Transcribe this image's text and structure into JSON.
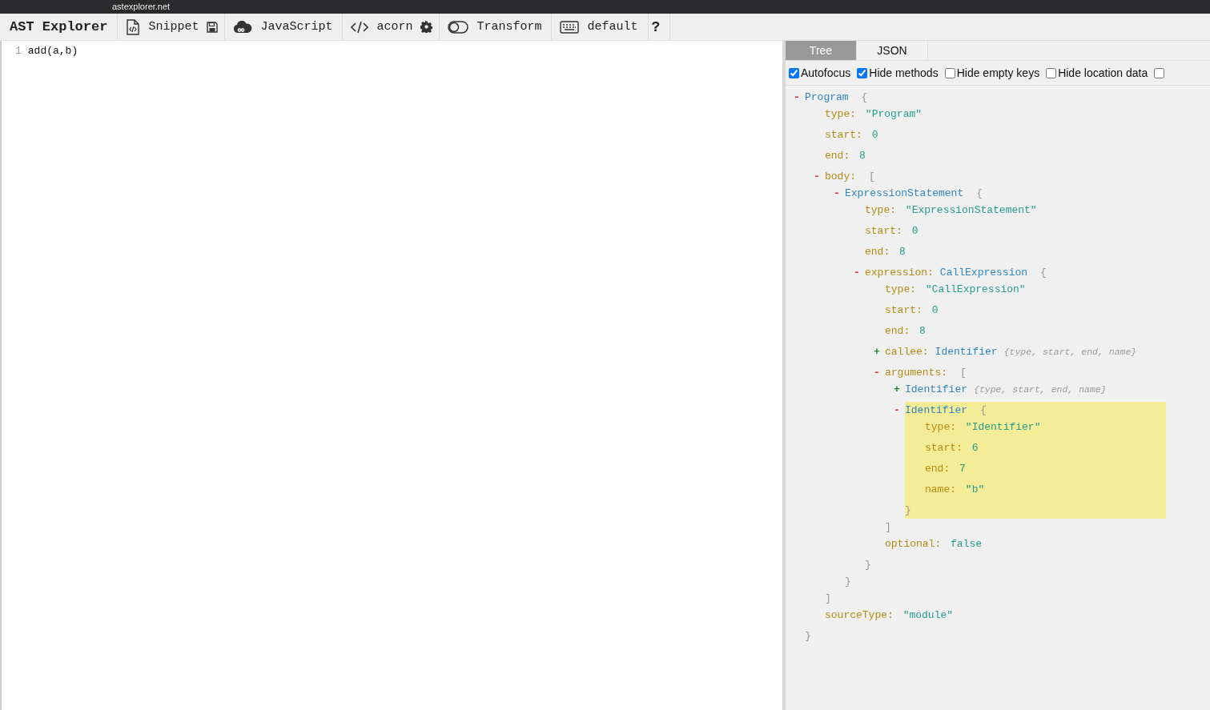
{
  "browser": {
    "url": "astexplorer.net"
  },
  "toolbar": {
    "brand": "AST Explorer",
    "items": [
      {
        "kind": "snippet",
        "label": "Snippet"
      },
      {
        "kind": "language",
        "label": "JavaScript"
      },
      {
        "kind": "parser",
        "label": "acorn"
      },
      {
        "kind": "transform",
        "label": "Transform"
      },
      {
        "kind": "keymap",
        "label": "default"
      },
      {
        "kind": "help",
        "label": "?"
      }
    ]
  },
  "editor": {
    "lines": [
      {
        "number": "1",
        "code": "add(a,b)"
      }
    ]
  },
  "output": {
    "tabs": [
      {
        "label": "Tree",
        "selected": true
      },
      {
        "label": "JSON",
        "selected": false
      }
    ],
    "options": [
      {
        "label": "Autofocus",
        "checked": true
      },
      {
        "label": "Hide methods",
        "checked": true
      },
      {
        "label": "Hide empty keys",
        "checked": false
      },
      {
        "label": "Hide location data",
        "checked": false
      },
      {
        "checked": false
      }
    ],
    "tree": {
      "kind": "object",
      "type_name": "Program",
      "toggle": "-",
      "expanded": true,
      "highlighted": false,
      "open": "{",
      "close": "}",
      "children": [
        {
          "kind": "prop",
          "key": "type:",
          "value": "\"Program\""
        },
        {
          "kind": "prop",
          "key": "start:",
          "value": "0"
        },
        {
          "kind": "prop",
          "key": "end:",
          "value": "8"
        },
        {
          "kind": "object",
          "key": "body:",
          "toggle": "-",
          "expanded": true,
          "highlighted": false,
          "open": "[",
          "close": "]",
          "children": [
            {
              "kind": "object",
              "type_name": "ExpressionStatement",
              "toggle": "-",
              "expanded": true,
              "highlighted": false,
              "open": "{",
              "close": "}",
              "children": [
                {
                  "kind": "prop",
                  "key": "type:",
                  "value": "\"ExpressionStatement\""
                },
                {
                  "kind": "prop",
                  "key": "start:",
                  "value": "0"
                },
                {
                  "kind": "prop",
                  "key": "end:",
                  "value": "8"
                },
                {
                  "kind": "object",
                  "key": "expression:",
                  "type_name": "CallExpression",
                  "toggle": "-",
                  "expanded": true,
                  "highlighted": false,
                  "open": "{",
                  "close": "}",
                  "children": [
                    {
                      "kind": "prop",
                      "key": "type:",
                      "value": "\"CallExpression\""
                    },
                    {
                      "kind": "prop",
                      "key": "start:",
                      "value": "0"
                    },
                    {
                      "kind": "prop",
                      "key": "end:",
                      "value": "8"
                    },
                    {
                      "kind": "object",
                      "key": "callee:",
                      "type_name": "Identifier",
                      "toggle": "+",
                      "expanded": false,
                      "highlighted": false,
                      "summary": "{type, start, end, name}"
                    },
                    {
                      "kind": "object",
                      "key": "arguments:",
                      "toggle": "-",
                      "expanded": true,
                      "highlighted": false,
                      "open": "[",
                      "close": "]",
                      "children": [
                        {
                          "kind": "object",
                          "type_name": "Identifier",
                          "toggle": "+",
                          "expanded": false,
                          "highlighted": false,
                          "summary": "{type, start, end, name}"
                        },
                        {
                          "kind": "object",
                          "type_name": "Identifier",
                          "toggle": "-",
                          "expanded": true,
                          "highlighted": true,
                          "open": "{",
                          "close": "}",
                          "children": [
                            {
                              "kind": "prop",
                              "key": "type:",
                              "value": "\"Identifier\""
                            },
                            {
                              "kind": "prop",
                              "key": "start:",
                              "value": "6"
                            },
                            {
                              "kind": "prop",
                              "key": "end:",
                              "value": "7"
                            },
                            {
                              "kind": "prop",
                              "key": "name:",
                              "value": "\"b\""
                            }
                          ]
                        }
                      ]
                    },
                    {
                      "kind": "prop",
                      "key": "optional:",
                      "value": "false"
                    }
                  ]
                }
              ]
            }
          ]
        },
        {
          "kind": "prop",
          "key": "sourceType:",
          "value": "\"module\""
        }
      ]
    }
  }
}
